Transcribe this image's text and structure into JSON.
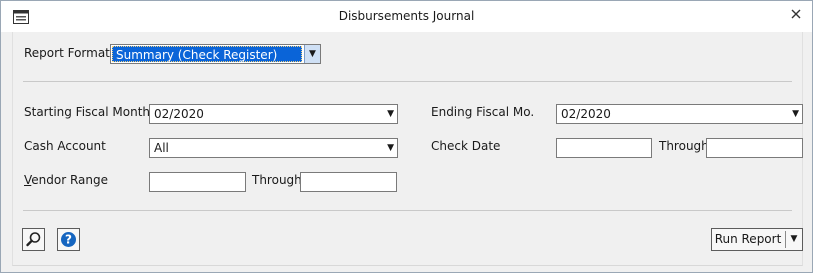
{
  "window": {
    "title": "Disbursements Journal"
  },
  "report_format": {
    "label": "Report Format",
    "value": "Summary (Check Register)"
  },
  "starting_fiscal_month": {
    "label": "Starting Fiscal Month",
    "value": "02/2020"
  },
  "ending_fiscal_month": {
    "label": "Ending Fiscal Mo.",
    "value": "02/2020"
  },
  "cash_account": {
    "label": "Cash Account",
    "value": "All"
  },
  "check_date": {
    "label": "Check Date",
    "from_value": "",
    "through_label": "Through",
    "to_value": ""
  },
  "vendor_range": {
    "label_first": "V",
    "label_rest": "endor Range",
    "from_value": "",
    "through_label": "Through",
    "to_value": ""
  },
  "footer": {
    "run_report_label": "Run Report"
  },
  "icons": {
    "window": "window-icon",
    "close": "close-icon",
    "search": "magnifier-icon",
    "help": "help-icon",
    "dropdown": "chevron-down-icon"
  },
  "colors": {
    "selection": "#0a64d8",
    "help_icon": "#1565c0",
    "dropdown_button": "#cfe0f5"
  }
}
